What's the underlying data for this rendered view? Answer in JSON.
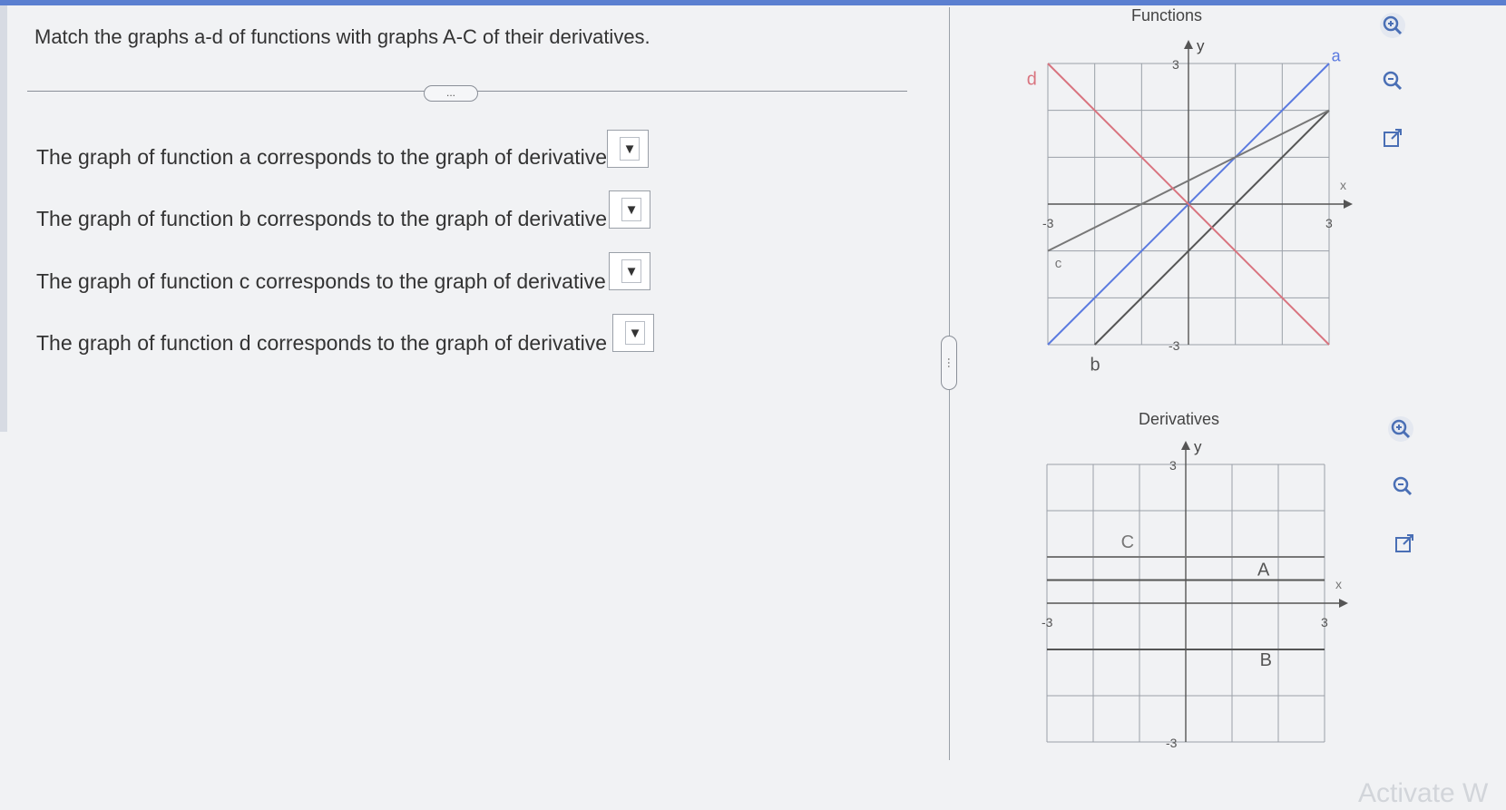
{
  "instruction": "Match the graphs a-d of functions with graphs A-C of their derivatives.",
  "more_label": "...",
  "questions": [
    {
      "text": "The graph of function a corresponds to the graph of derivative",
      "selected": ""
    },
    {
      "text": "The graph of function b corresponds to the graph of derivative",
      "selected": ""
    },
    {
      "text": "The graph of function c corresponds to the graph of derivative",
      "selected": ""
    },
    {
      "text": "The graph of function d corresponds to the graph of derivative",
      "selected": ""
    }
  ],
  "dropdown_arrow": "▼",
  "splitter_label": "⋯",
  "functions_graph": {
    "title": "Functions",
    "y_axis_label": "y",
    "x_axis_label": "x",
    "tick_y_top": "3",
    "tick_y_bottom": "-3",
    "tick_x_left": "-3",
    "tick_x_right": "3",
    "line_labels": {
      "a": "a",
      "b": "b",
      "c": "c",
      "d": "d"
    },
    "colors": {
      "a": "#5b7ae0",
      "b": "#555555",
      "c": "#777777",
      "d": "#d9747f"
    },
    "chart_data": {
      "type": "line",
      "xlim": [
        -3,
        3
      ],
      "ylim": [
        -3,
        3
      ],
      "grid": true,
      "series": [
        {
          "name": "a",
          "x": [
            -3,
            3
          ],
          "y": [
            -3,
            3
          ]
        },
        {
          "name": "b",
          "x": [
            -2,
            3
          ],
          "y": [
            -3,
            2
          ]
        },
        {
          "name": "c",
          "x": [
            -3,
            3
          ],
          "y": [
            -1,
            2
          ]
        },
        {
          "name": "d",
          "x": [
            -3,
            3
          ],
          "y": [
            3,
            -3
          ]
        }
      ]
    }
  },
  "derivatives_graph": {
    "title": "Derivatives",
    "y_axis_label": "y",
    "x_axis_label": "x",
    "tick_y_top": "3",
    "tick_y_bottom": "-3",
    "tick_x_left": "-3",
    "tick_x_right": "3",
    "line_labels": {
      "A": "A",
      "B": "B",
      "C": "C"
    },
    "colors": {
      "A": "#555555",
      "B": "#555555",
      "C": "#777777"
    },
    "chart_data": {
      "type": "line",
      "xlim": [
        -3,
        3
      ],
      "ylim": [
        -3,
        3
      ],
      "grid": true,
      "series": [
        {
          "name": "A",
          "x": [
            -3,
            3
          ],
          "y": [
            0.5,
            0.5
          ]
        },
        {
          "name": "B",
          "x": [
            -3,
            3
          ],
          "y": [
            -1,
            -1
          ]
        },
        {
          "name": "C",
          "x": [
            -3,
            3
          ],
          "y": [
            1,
            1
          ]
        }
      ]
    }
  },
  "tools": {
    "zoom_in": "zoom-in",
    "zoom_out": "zoom-out",
    "pop_out": "open-new-window"
  },
  "watermark": "Activate W"
}
